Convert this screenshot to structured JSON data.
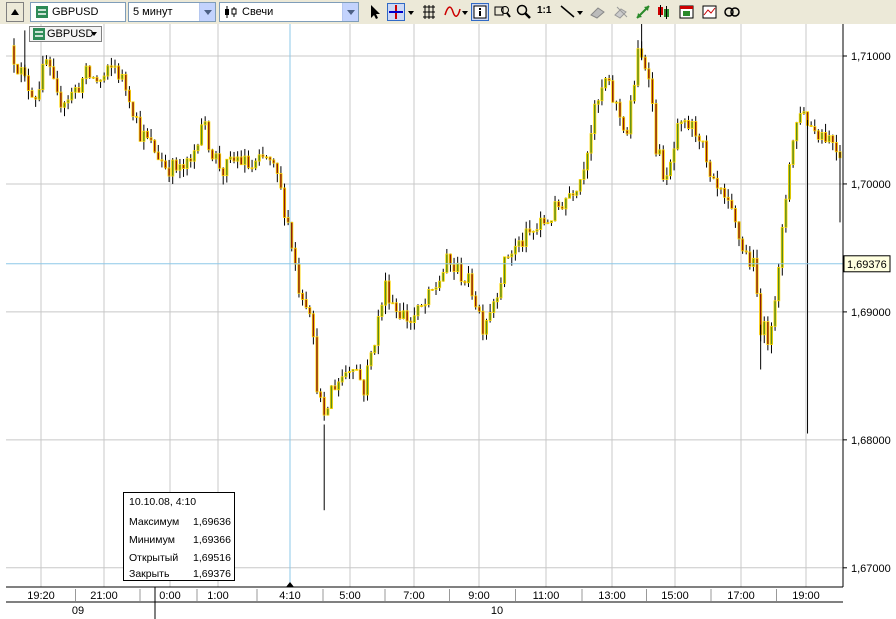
{
  "toolbar": {
    "symbol": "GBPUSD",
    "timeframe": "5 минут",
    "chart_type": "Свечи",
    "zoom_label": "1:1"
  },
  "chart_symbol_tag": "GBPUSD",
  "colors": {
    "up_fill": "#5b8c1a",
    "down_fill": "#8b1a0e",
    "candle_border": "#ffd800",
    "grid": "#c8c8c8",
    "crosshair": "#8ec8e8"
  },
  "crosshair": {
    "price_label": "1,69376",
    "time_label": "4:10"
  },
  "tooltip": {
    "datetime": "10.10.08, 4:10",
    "rows": [
      {
        "label": "Максимум",
        "value": "1,69636"
      },
      {
        "label": "Минимум",
        "value": "1,69366"
      },
      {
        "label": "Открытый",
        "value": "1,69516"
      },
      {
        "label": "Закрыть",
        "value": "1,69376"
      }
    ]
  },
  "chart_data": {
    "type": "candlestick",
    "symbol": "GBPUSD",
    "timeframe": "5 минут",
    "y_ticks": [
      "1,71000",
      "1,70000",
      "1,69000",
      "1,68000",
      "1,67000"
    ],
    "y_tick_values": [
      1.71,
      1.7,
      1.69,
      1.68,
      1.67
    ],
    "ylim": [
      1.6685,
      1.7125
    ],
    "x_ticks": [
      "19:20",
      "21:00",
      "0:00",
      "1:00",
      "4:10",
      "5:00",
      "7:00",
      "9:00",
      "11:00",
      "13:00",
      "15:00",
      "17:00",
      "19:00"
    ],
    "date_labels": [
      "09",
      "10"
    ],
    "close_path": [
      [
        0,
        1.71
      ],
      [
        3,
        1.708
      ],
      [
        6,
        1.707
      ],
      [
        9,
        1.7095
      ],
      [
        12,
        1.7065
      ],
      [
        16,
        1.707
      ],
      [
        20,
        1.7085
      ],
      [
        24,
        1.708
      ],
      [
        28,
        1.7092
      ],
      [
        32,
        1.707
      ],
      [
        35,
        1.704
      ],
      [
        38,
        1.703
      ],
      [
        42,
        1.7015
      ],
      [
        46,
        1.701
      ],
      [
        49,
        1.7015
      ],
      [
        52,
        1.705
      ],
      [
        55,
        1.7025
      ],
      [
        58,
        1.701
      ],
      [
        62,
        1.702
      ],
      [
        66,
        1.7012
      ],
      [
        70,
        1.702
      ],
      [
        73,
        1.7005
      ],
      [
        76,
        1.697
      ],
      [
        79,
        1.692
      ],
      [
        82,
        1.6905
      ],
      [
        84,
        1.6845
      ],
      [
        86,
        1.6812
      ],
      [
        88,
        1.684
      ],
      [
        91,
        1.685
      ],
      [
        94,
        1.6862
      ],
      [
        97,
        1.684
      ],
      [
        100,
        1.688
      ],
      [
        103,
        1.692
      ],
      [
        106,
        1.6903
      ],
      [
        110,
        1.6893
      ],
      [
        114,
        1.6905
      ],
      [
        117,
        1.692
      ],
      [
        120,
        1.6938
      ],
      [
        124,
        1.693
      ],
      [
        127,
        1.6918
      ],
      [
        130,
        1.689
      ],
      [
        133,
        1.691
      ],
      [
        137,
        1.6945
      ],
      [
        141,
        1.6955
      ],
      [
        145,
        1.6965
      ],
      [
        149,
        1.6975
      ],
      [
        153,
        1.699
      ],
      [
        157,
        1.7005
      ],
      [
        161,
        1.7055
      ],
      [
        164,
        1.708
      ],
      [
        167,
        1.706
      ],
      [
        170,
        1.704
      ],
      [
        173,
        1.71
      ],
      [
        176,
        1.709
      ],
      [
        178,
        1.703
      ],
      [
        181,
        1.7
      ],
      [
        184,
        1.704
      ],
      [
        187,
        1.7045
      ],
      [
        190,
        1.704
      ],
      [
        193,
        1.7
      ],
      [
        196,
        1.699
      ],
      [
        199,
        1.6975
      ],
      [
        202,
        1.695
      ],
      [
        205,
        1.6935
      ],
      [
        207,
        1.689
      ],
      [
        209,
        1.688
      ],
      [
        212,
        1.693
      ],
      [
        215,
        1.702
      ],
      [
        218,
        1.706
      ],
      [
        221,
        1.7045
      ],
      [
        224,
        1.704
      ],
      [
        227,
        1.7035
      ],
      [
        229,
        1.7025
      ]
    ]
  }
}
